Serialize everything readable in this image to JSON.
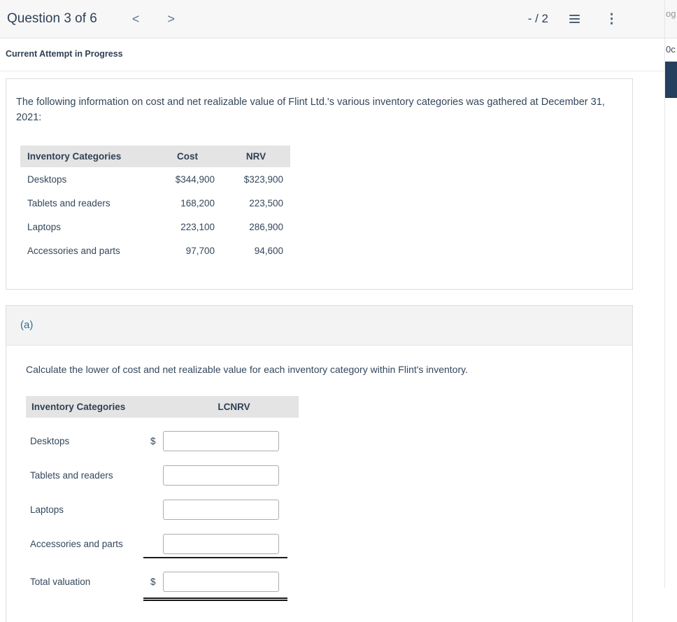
{
  "header": {
    "title": "Question 3 of 6",
    "score": "- / 2",
    "icons": {
      "prev": "<",
      "next": ">",
      "kebab": "⋮"
    }
  },
  "edge": {
    "top_text": "og",
    "mid_text": "0c"
  },
  "attempt": {
    "label": "Current Attempt in Progress"
  },
  "problem": {
    "intro": "The following information on cost and net realizable value of Flint Ltd.'s various inventory categories was gathered at December 31, 2021:",
    "table": {
      "headers": [
        "Inventory Categories",
        "Cost",
        "NRV"
      ],
      "rows": [
        {
          "category": "Desktops",
          "cost": "$344,900",
          "nrv": "$323,900"
        },
        {
          "category": "Tablets and readers",
          "cost": "168,200",
          "nrv": "223,500"
        },
        {
          "category": "Laptops",
          "cost": "223,100",
          "nrv": "286,900"
        },
        {
          "category": "Accessories and parts",
          "cost": "97,700",
          "nrv": "94,600"
        }
      ]
    }
  },
  "part_a": {
    "label": "(a)",
    "instruction": "Calculate the lower of cost and net realizable value for each inventory category within Flint's inventory.",
    "table": {
      "headers": [
        "Inventory Categories",
        "LCNRV"
      ],
      "rows": [
        {
          "category": "Desktops",
          "prefix": "$",
          "value": ""
        },
        {
          "category": "Tablets and readers",
          "prefix": "",
          "value": ""
        },
        {
          "category": "Laptops",
          "prefix": "",
          "value": ""
        },
        {
          "category": "Accessories and parts",
          "prefix": "",
          "value": ""
        },
        {
          "category": "Total valuation",
          "prefix": "$",
          "value": ""
        }
      ]
    }
  },
  "colors": {
    "accent": "#31708f",
    "navy_block": "#24405e",
    "header_text": "#2f4154",
    "table_header_bg": "#e4e4e4"
  }
}
